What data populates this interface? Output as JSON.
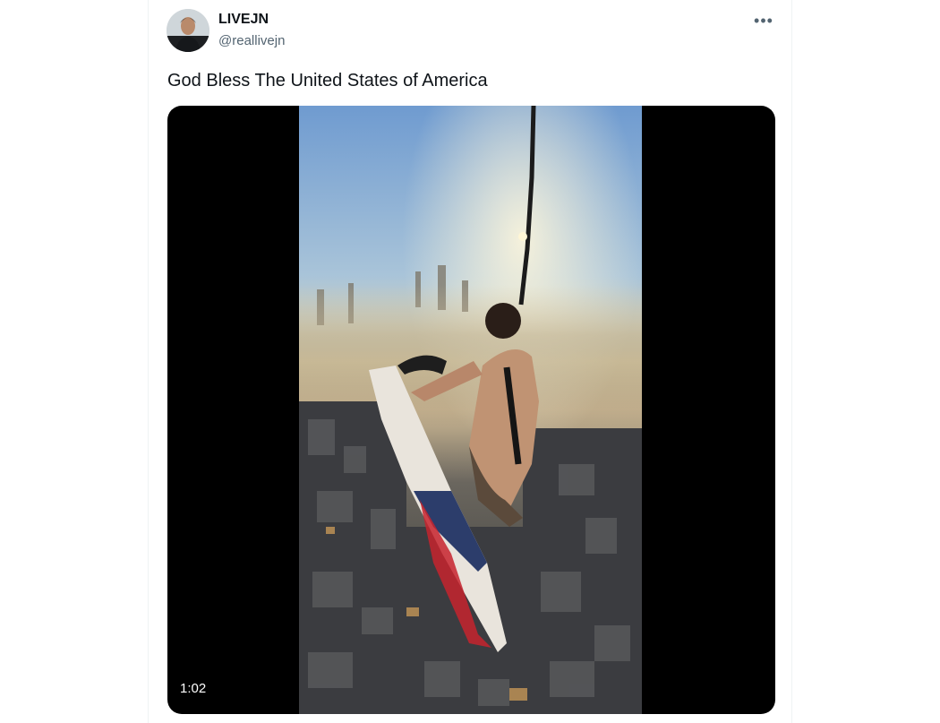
{
  "tweet": {
    "author": {
      "display_name": "LIVEJN",
      "handle": "@reallivejn",
      "avatar_icon": "avatar-photo"
    },
    "more_icon": "more-horizontal-icon",
    "more_glyph": "•••",
    "text": "God Bless The United States of America",
    "media": {
      "type": "video",
      "duration": "1:02"
    }
  },
  "colors": {
    "text_primary": "#0f1419",
    "text_secondary": "#536471",
    "media_background": "#000000"
  }
}
